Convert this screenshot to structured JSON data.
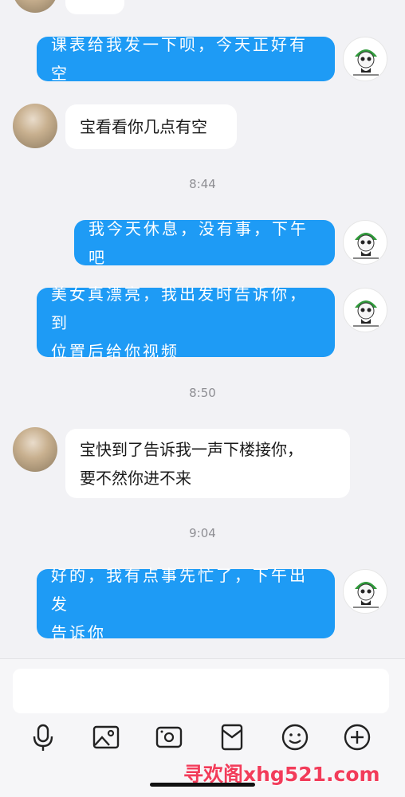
{
  "messages": [
    {
      "side": "me",
      "text": "课表给我发一下呗，今天正好有空"
    },
    {
      "side": "other",
      "text": "宝看看你几点有空"
    },
    {
      "time": "8:44"
    },
    {
      "side": "me",
      "text": "我今天休息，没有事，下午吧"
    },
    {
      "side": "me",
      "line1": "美女真漂亮，我出发时告诉你，到",
      "line2": "位置后给你视频"
    },
    {
      "time": "8:50"
    },
    {
      "side": "other",
      "line1": "宝快到了告诉我一声下楼接你，",
      "line2": "要不然你进不来"
    },
    {
      "time": "9:04"
    },
    {
      "side": "me",
      "line1": "好的，我有点事先忙了，下午出发",
      "line2": "告诉你"
    }
  ],
  "toolbar": {
    "icons": [
      "microphone-icon",
      "image-icon",
      "camera-icon",
      "red-packet-icon",
      "emoji-icon",
      "plus-icon"
    ]
  },
  "watermark": "寻欢阁xhg521.com",
  "colors": {
    "my_bubble": "#1e9bf5",
    "other_bubble": "#ffffff",
    "background": "#f2f2f5",
    "watermark": "#f23c5a"
  }
}
